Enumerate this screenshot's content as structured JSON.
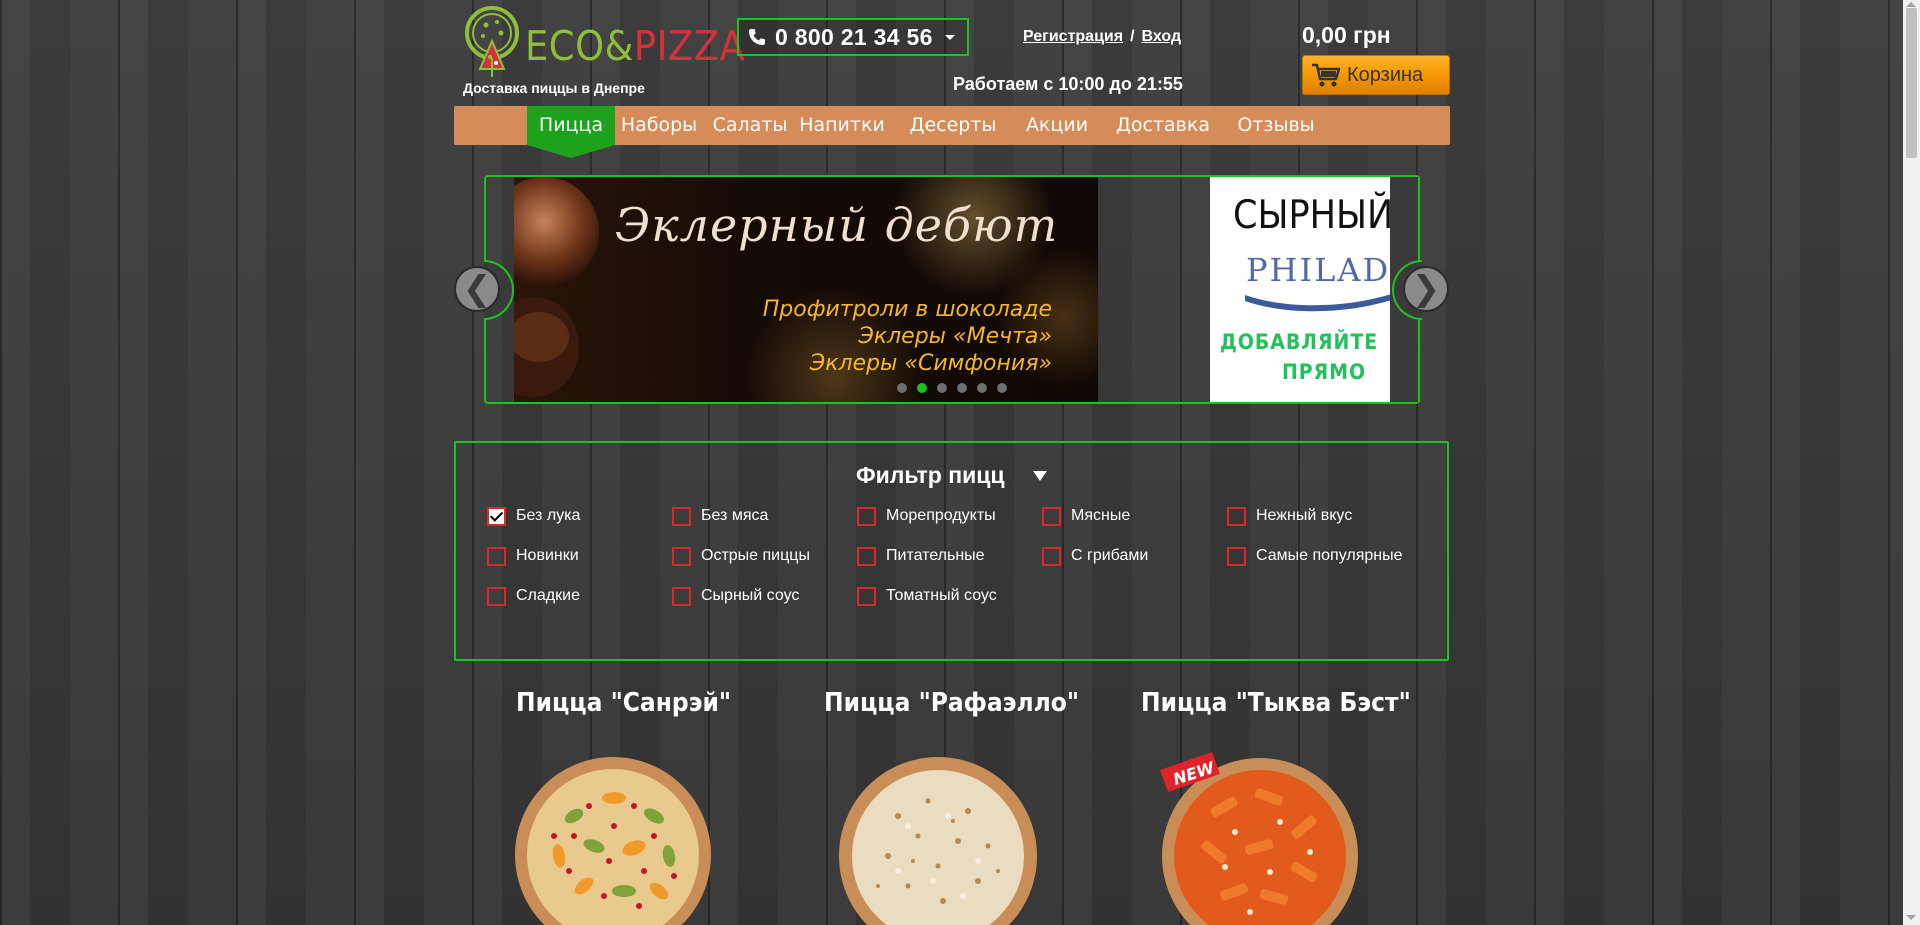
{
  "header": {
    "logo_text_eco": "ECO&",
    "logo_text_pizza": "PIZZA",
    "tagline": "Доставка пиццы в Днепре",
    "phone": "0 800 21 34 56",
    "auth_register": "Регистрация",
    "auth_separator": "/",
    "auth_login": "Вход",
    "hours": "Работаем с 10:00 до 21:55",
    "cart_total": "0,00 грн",
    "cart_label": "Корзина"
  },
  "nav": {
    "items": [
      {
        "label": "Пицца",
        "active": true
      },
      {
        "label": "Наборы"
      },
      {
        "label": "Салаты"
      },
      {
        "label": "Напитки"
      },
      {
        "label": "Десерты"
      },
      {
        "label": "Акции"
      },
      {
        "label": "Доставка"
      },
      {
        "label": "Отзывы"
      }
    ]
  },
  "slider": {
    "prev_label": "❮",
    "next_label": "❯",
    "slide1": {
      "title": "Эклерный дебют",
      "lines": [
        "Профитроли в шоколаде",
        "Эклеры «Мечта»",
        "Эклеры «Симфония»"
      ]
    },
    "slide2": {
      "title": "СЫРНЫЙ",
      "brand": "PHILAD",
      "lines": [
        "ДОБАВЛЯЙТЕ",
        "ПРЯМО"
      ]
    },
    "dots_count": 6,
    "active_dot": 1
  },
  "filter": {
    "title": "Фильтр пицц",
    "options": [
      {
        "label": "Без лука",
        "checked": true
      },
      {
        "label": "Без мяса",
        "checked": false
      },
      {
        "label": "Морепродукты",
        "checked": false
      },
      {
        "label": "Мясные",
        "checked": false
      },
      {
        "label": "Нежный вкус",
        "checked": false
      },
      {
        "label": "Новинки",
        "checked": false
      },
      {
        "label": "Острые пиццы",
        "checked": false
      },
      {
        "label": "Питательные",
        "checked": false
      },
      {
        "label": "С грибами",
        "checked": false
      },
      {
        "label": "Самые популярные",
        "checked": false
      },
      {
        "label": "Сладкие",
        "checked": false
      },
      {
        "label": "Сырный соус",
        "checked": false
      },
      {
        "label": "Томатный соус",
        "checked": false
      }
    ]
  },
  "products": [
    {
      "title": "Пицца \"Санрэй\""
    },
    {
      "title": "Пицца \"Рафаэлло\""
    },
    {
      "title": "Пицца \"Тыква Бэст\"",
      "badge": "NEW"
    }
  ],
  "colors": {
    "accent_green": "#1ec21e",
    "nav_bg": "#d68c58",
    "cart_orange": "#f39600",
    "checkbox_red": "#d12b2b"
  }
}
